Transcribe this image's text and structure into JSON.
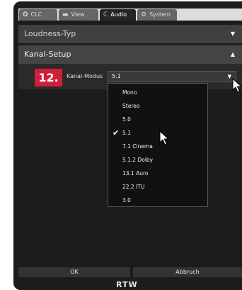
{
  "tabs": [
    {
      "label": "CLC",
      "icon": "clc-icon"
    },
    {
      "label": "View",
      "icon": "view-icon"
    },
    {
      "label": "Audio",
      "icon": "audio-icon"
    },
    {
      "label": "System",
      "icon": "gear-icon"
    }
  ],
  "active_tab": "Audio",
  "sections": {
    "loudness_type": "Loudness-Typ",
    "channel_setup": "Kanal-Setup"
  },
  "step_badge": "12.",
  "channel_mode": {
    "label": "Kanal-Modus",
    "value": "5.1",
    "options": [
      "Mono",
      "Stereo",
      "5.0",
      "5.1",
      "7.1 Cinema",
      "5.1.2 Dolby",
      "13.1 Auro",
      "22.2 ITU",
      "3.0"
    ],
    "selected": "5.1"
  },
  "buttons": {
    "ok": "OK",
    "cancel": "Abbruch"
  },
  "logo": "RTW"
}
